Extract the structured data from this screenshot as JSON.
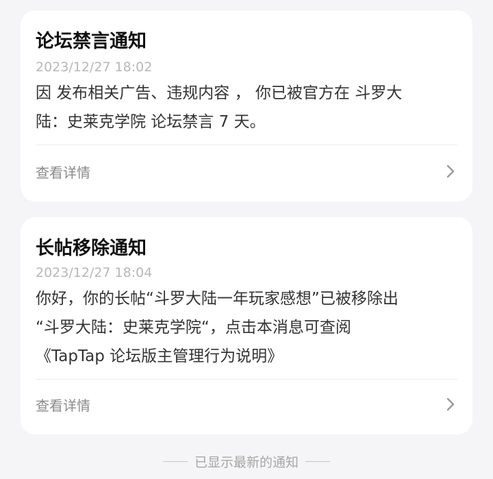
{
  "notifications": [
    {
      "title": "论坛禁言通知",
      "timestamp": "2023/12/27 18:02",
      "body_lines": [
        "因 发布相关广告、违规内容 ， 你已被官方在 斗罗大",
        "陆：史莱克学院 论坛禁言 7 天。"
      ],
      "details_label": "查看详情",
      "details_icon": "chevron-right-icon"
    },
    {
      "title": "长帖移除通知",
      "timestamp": "2023/12/27 18:04",
      "body_lines": [
        "你好，你的长帖“斗罗大陆一年玩家感想”已被移除出",
        "“斗罗大陆：史莱克学院“，点击本消息可查阅",
        "《TapTap 论坛版主管理行为说明》"
      ],
      "details_label": "查看详情",
      "details_icon": "chevron-right-icon"
    }
  ],
  "footer": {
    "text": "已显示最新的通知"
  },
  "colors": {
    "background": "#f5f5f7",
    "card": "#ffffff",
    "title": "#111111",
    "timestamp": "#b7b7b7",
    "body": "#333333",
    "secondary": "#8a8a8a"
  }
}
